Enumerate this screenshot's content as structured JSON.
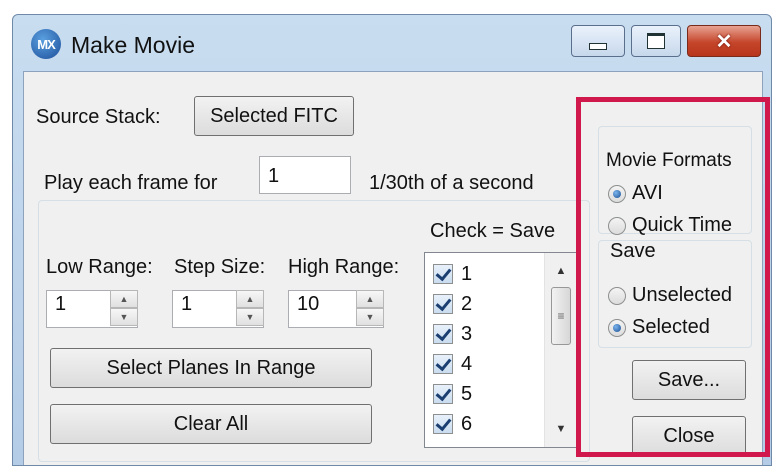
{
  "window": {
    "title": "Make Movie",
    "icon_text": "MX",
    "controls": {
      "minimize": "minimize",
      "maximize": "maximize",
      "close_glyph": "✕"
    }
  },
  "source": {
    "label": "Source Stack:",
    "button_label": "Selected FITC"
  },
  "play": {
    "label": "Play each frame for",
    "value": "1",
    "unit_label": "1/30th of a second"
  },
  "range": {
    "check_label": "Check = Save",
    "low": {
      "label": "Low Range:",
      "value": "1"
    },
    "step": {
      "label": "Step Size:",
      "value": "1"
    },
    "high": {
      "label": "High Range:",
      "value": "10"
    },
    "select_button": "Select Planes In Range",
    "clear_button": "Clear All"
  },
  "planes": {
    "items": [
      {
        "label": "1",
        "checked": true
      },
      {
        "label": "2",
        "checked": true
      },
      {
        "label": "3",
        "checked": true
      },
      {
        "label": "4",
        "checked": true
      },
      {
        "label": "5",
        "checked": true
      },
      {
        "label": "6",
        "checked": true
      }
    ],
    "scroll_up": "▲",
    "scroll_down": "▼",
    "thumb_grip": "≡"
  },
  "formats": {
    "title": "Movie Formats",
    "options": [
      {
        "label": "AVI",
        "selected": true
      },
      {
        "label": "Quick Time",
        "selected": false
      }
    ]
  },
  "save": {
    "title": "Save",
    "options": [
      {
        "label": "Unselected",
        "selected": false
      },
      {
        "label": "Selected",
        "selected": true
      }
    ],
    "save_button": "Save...",
    "close_button": "Close"
  },
  "highlight_color": "#d0184d"
}
